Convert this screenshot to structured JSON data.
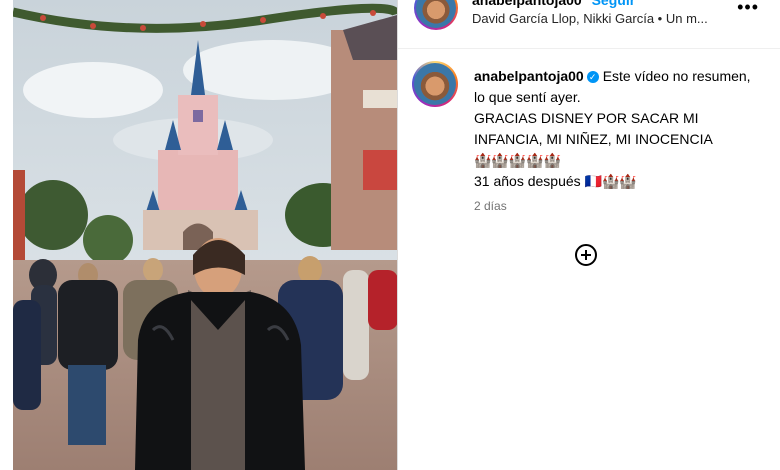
{
  "post": {
    "header": {
      "username": "anabelpantoja00",
      "follow_label": "Seguir",
      "subtitle": "David García Llop, Nikki García • Un m..."
    },
    "caption": {
      "username": "anabelpantoja00",
      "verified_icon": "verified-badge-icon",
      "line1": "Este vídeo no resumen, lo que sentí ayer.",
      "line2": "GRACIAS DISNEY POR SACAR MI INFANCIA, MI NIÑEZ, MI INOCENCIA",
      "line3": "🏰🏰🏰🏰🏰",
      "line4": "31 años después 🇫🇷🏰🏰"
    },
    "timestamp": "2 días",
    "more_icon": "more-options-icon",
    "add_icon": "add-comment-icon"
  },
  "colors": {
    "link_blue": "#0095f6",
    "muted_text": "#737373",
    "border": "#dbdbdb"
  }
}
